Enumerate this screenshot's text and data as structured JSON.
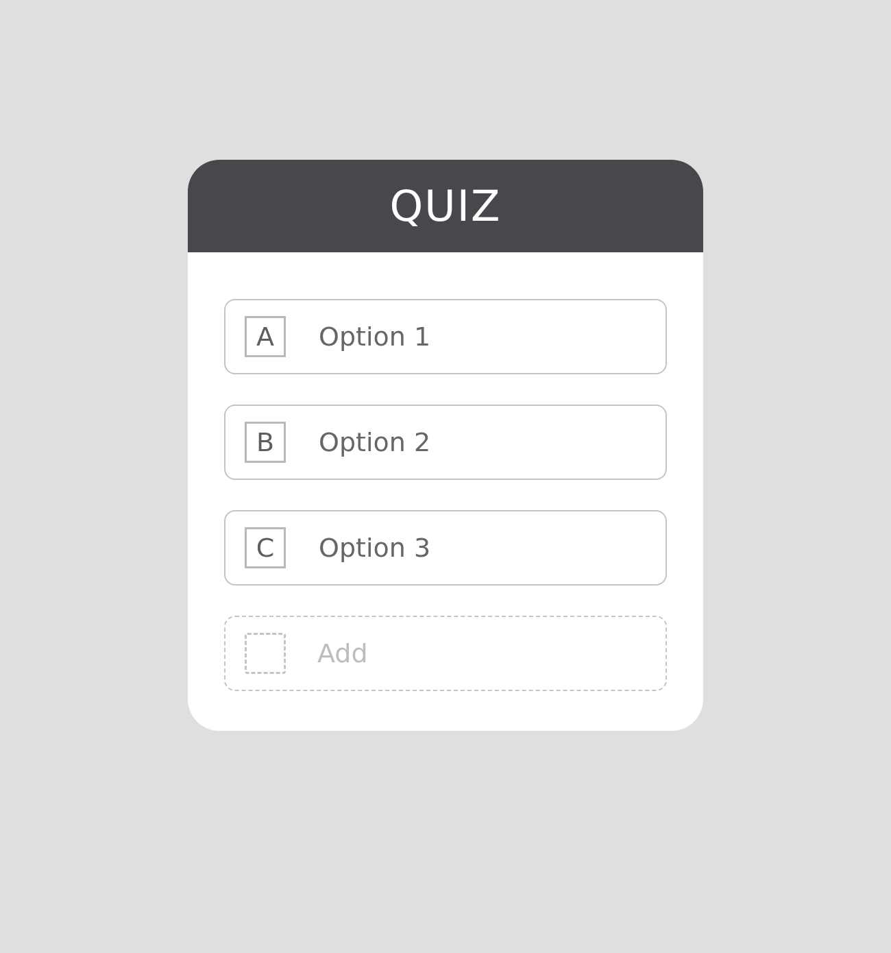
{
  "quiz": {
    "title": "QUIZ",
    "options": [
      {
        "letter": "A",
        "label": "Option 1"
      },
      {
        "letter": "B",
        "label": "Option 2"
      },
      {
        "letter": "C",
        "label": "Option 3"
      }
    ],
    "add_option": {
      "label": "Add"
    }
  }
}
